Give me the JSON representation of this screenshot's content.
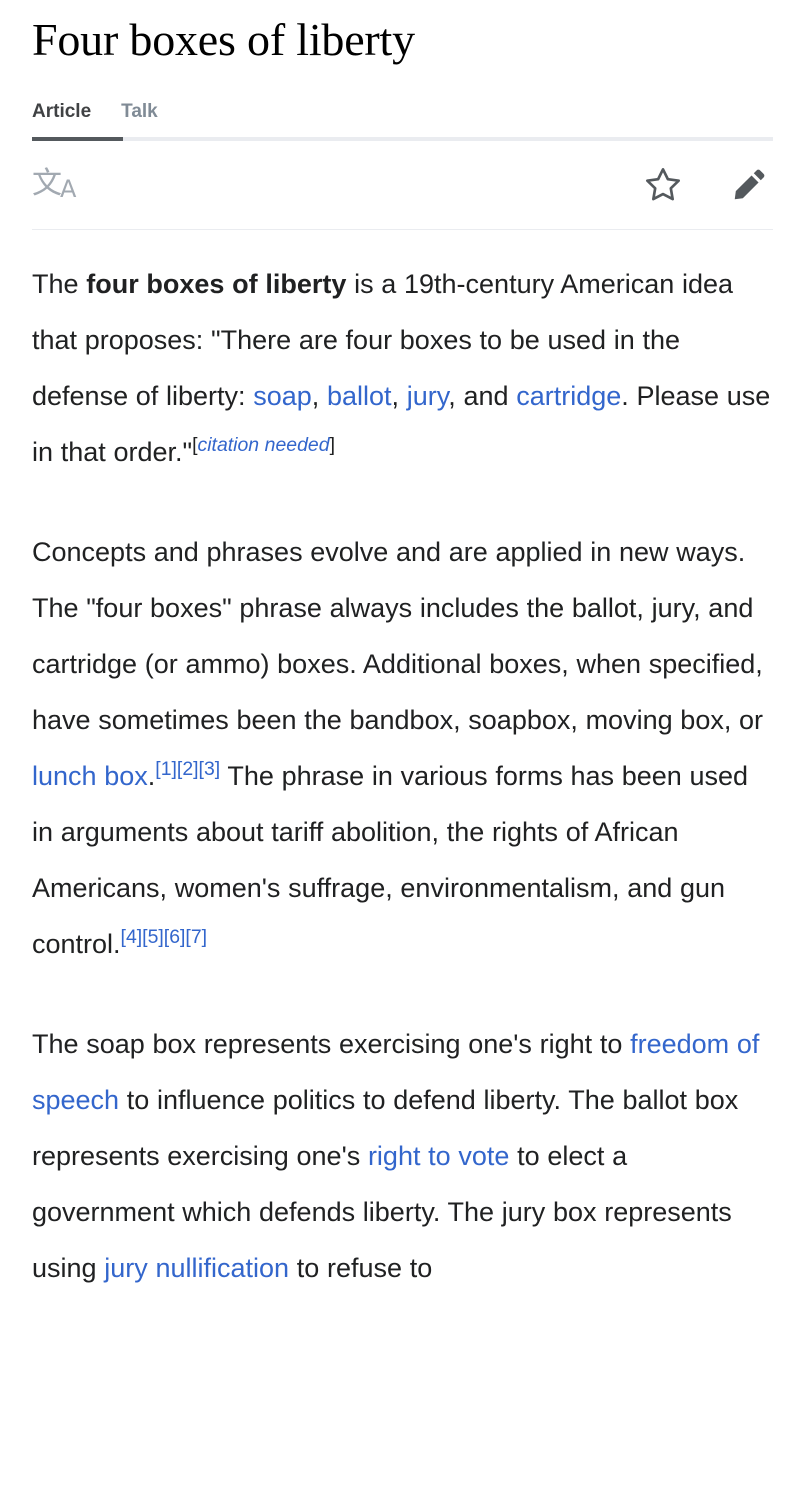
{
  "article": {
    "title": "Four boxes of liberty"
  },
  "tabs": [
    {
      "label": "Article",
      "active": true
    },
    {
      "label": "Talk",
      "active": false
    }
  ],
  "toolbar": {
    "language_icon": "language-icon",
    "language_glyph_main": "文",
    "language_glyph_sub": "A",
    "watch_icon": "star-icon",
    "edit_icon": "pencil-icon"
  },
  "colors": {
    "link": "#3366cc",
    "text": "#202122",
    "tab_active": "#404244",
    "tab_inactive": "#808b96",
    "rule": "#eaecf0",
    "active_bar": "#54595d",
    "lang_icon": "#a2a9b1",
    "action_icon": "#54595d"
  },
  "paragraphs": {
    "p1": {
      "s1": "The ",
      "bold": "four boxes of liberty",
      "s2": " is a 19th-century American idea that proposes: \"There are four boxes to be used in the defense of liberty: ",
      "link_soap": "soap",
      "s3": ", ",
      "link_ballot": "ballot",
      "s4": ", ",
      "link_jury": "jury",
      "s5": ", and ",
      "link_cartridge": "cartridge",
      "s6": ". Please use in that order.\"",
      "citation_needed_open": "[",
      "citation_needed_text": "citation needed",
      "citation_needed_close": "]"
    },
    "p2": {
      "s1": "Concepts and phrases evolve and are applied in new ways. The \"four boxes\" phrase always includes the ballot, jury, and cartridge (or ammo) boxes. Additional boxes, when specified, have sometimes been the bandbox, soapbox, moving box, or ",
      "link_lunchbox": "lunch box",
      "s2": ".",
      "refs_a": [
        "[1]",
        "[2]",
        "[3]"
      ],
      "s3": " The phrase in various forms has been used in arguments about tariff abolition, the rights of African Americans, women's suffrage, environmentalism, and gun control.",
      "refs_b": [
        "[4]",
        "[5]",
        "[6]",
        "[7]"
      ]
    },
    "p3": {
      "s1": "The soap box represents exercising one's right to ",
      "link_speech": "freedom of speech",
      "s2": " to influence politics to defend liberty. The ballot box represents exercising one's ",
      "link_vote": "right to vote",
      "s3": " to elect a government which defends liberty. The jury box represents using ",
      "link_nullification": "jury nullification",
      "s4": " to refuse to"
    }
  }
}
